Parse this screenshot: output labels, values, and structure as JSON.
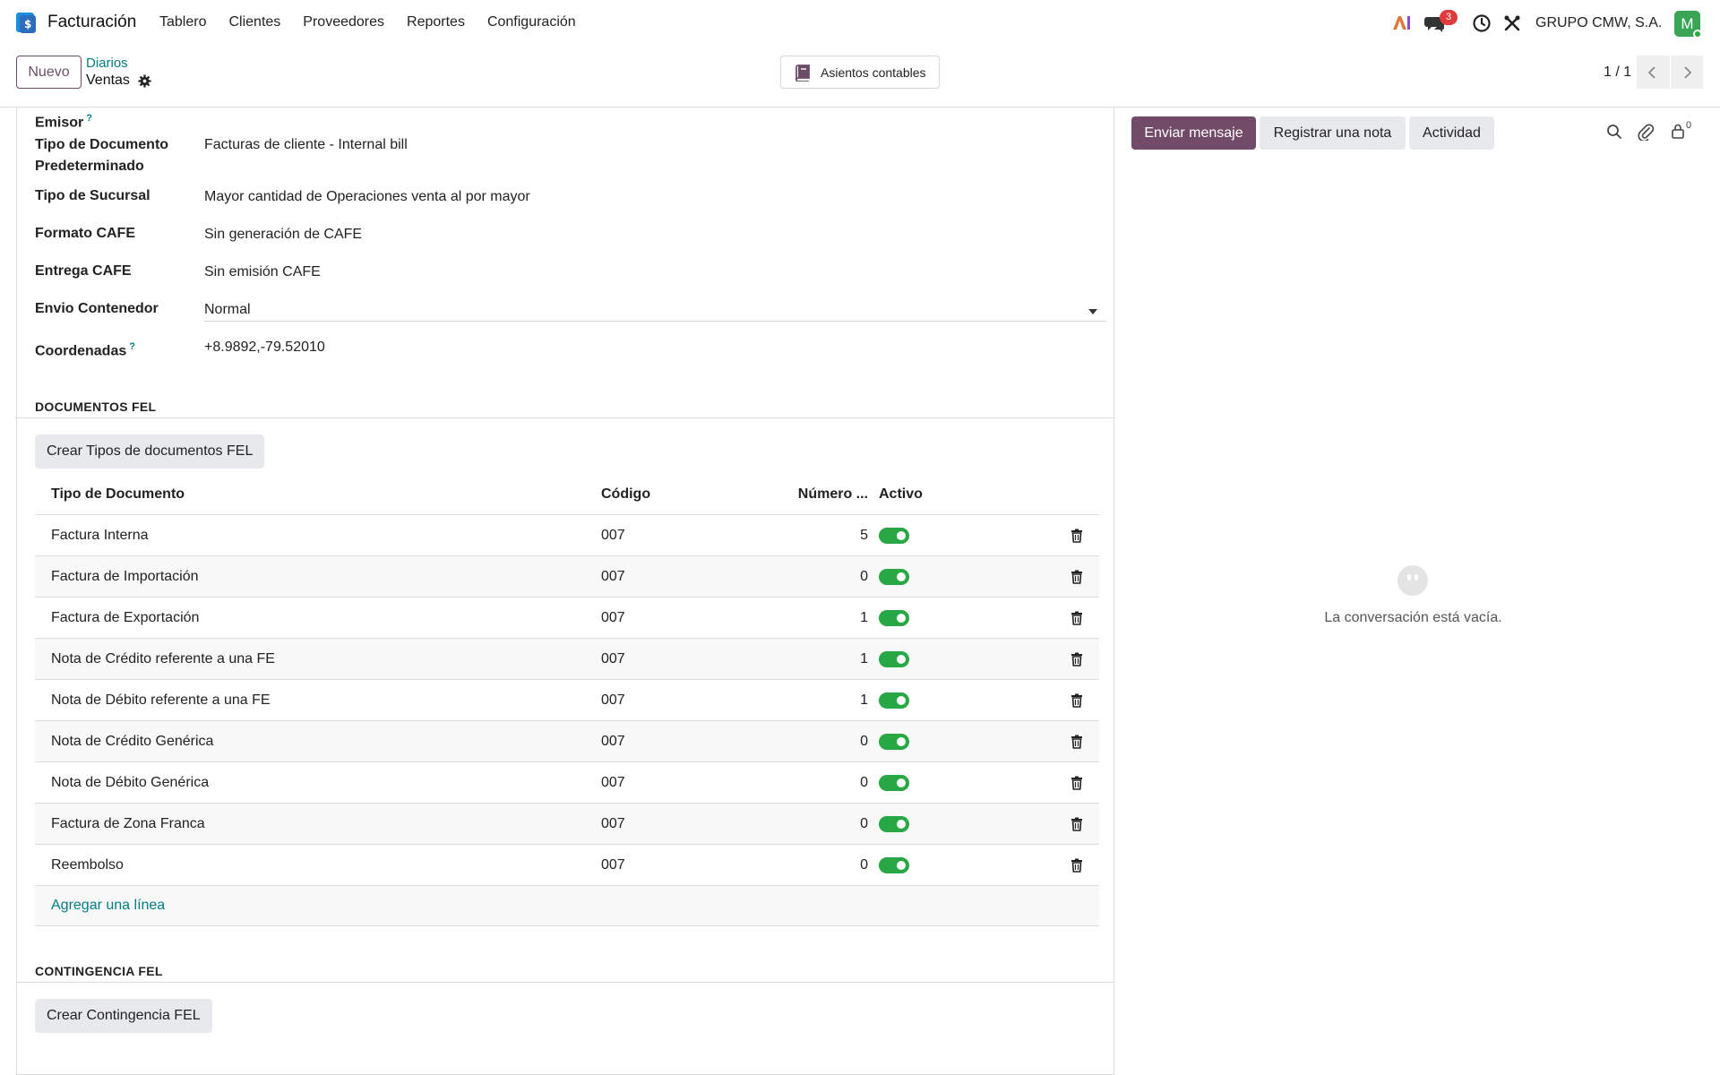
{
  "navbar": {
    "app_name": "Facturación",
    "menu": [
      "Tablero",
      "Clientes",
      "Proveedores",
      "Reportes",
      "Configuración"
    ],
    "chat_badge": "3",
    "company": "GRUPO CMW, S.A.",
    "avatar_letter": "M"
  },
  "control": {
    "new_label": "Nuevo",
    "breadcrumb_parent": "Diarios",
    "breadcrumb_current": "Ventas",
    "smart_button": "Asientos contables",
    "pager": "1 / 1"
  },
  "form": {
    "emisor_label": "Emisor",
    "tipo_doc_label_1": "Tipo de Documento",
    "tipo_doc_label_2": "Predeterminado",
    "tipo_doc_value": "Facturas de cliente - Internal bill",
    "sucursal_label": "Tipo de Sucursal",
    "sucursal_value": "Mayor cantidad de Operaciones venta al por mayor",
    "formato_label": "Formato CAFE",
    "formato_value": "Sin generación de CAFE",
    "entrega_label": "Entrega CAFE",
    "entrega_value": "Sin emisión CAFE",
    "envio_label": "Envio Contenedor",
    "envio_value": "Normal",
    "coord_label": "Coordenadas",
    "coord_value": "+8.9892,-79.52010",
    "help_mark": "?"
  },
  "documentos": {
    "title": "DOCUMENTOS FEL",
    "create_button": "Crear Tipos de documentos FEL",
    "columns": [
      "Tipo de Documento",
      "Código",
      "Número ...",
      "Activo"
    ],
    "rows": [
      {
        "tipo": "Factura Interna",
        "codigo": "007",
        "numero": "5"
      },
      {
        "tipo": "Factura de Importación",
        "codigo": "007",
        "numero": "0"
      },
      {
        "tipo": "Factura de Exportación",
        "codigo": "007",
        "numero": "1"
      },
      {
        "tipo": "Nota de Crédito referente a una FE",
        "codigo": "007",
        "numero": "1"
      },
      {
        "tipo": "Nota de Débito referente a una FE",
        "codigo": "007",
        "numero": "1"
      },
      {
        "tipo": "Nota de Crédito Genérica",
        "codigo": "007",
        "numero": "0"
      },
      {
        "tipo": "Nota de Débito Genérica",
        "codigo": "007",
        "numero": "0"
      },
      {
        "tipo": "Factura de Zona Franca",
        "codigo": "007",
        "numero": "0"
      },
      {
        "tipo": "Reembolso",
        "codigo": "007",
        "numero": "0"
      }
    ],
    "add_line": "Agregar una línea"
  },
  "contingencia": {
    "title": "CONTINGENCIA FEL",
    "create_button": "Crear Contingencia FEL"
  },
  "chatter": {
    "send_message": "Enviar mensaje",
    "log_note": "Registrar una nota",
    "activity": "Actividad",
    "followers_count": "0",
    "empty_text": "La conversación está vacía."
  }
}
